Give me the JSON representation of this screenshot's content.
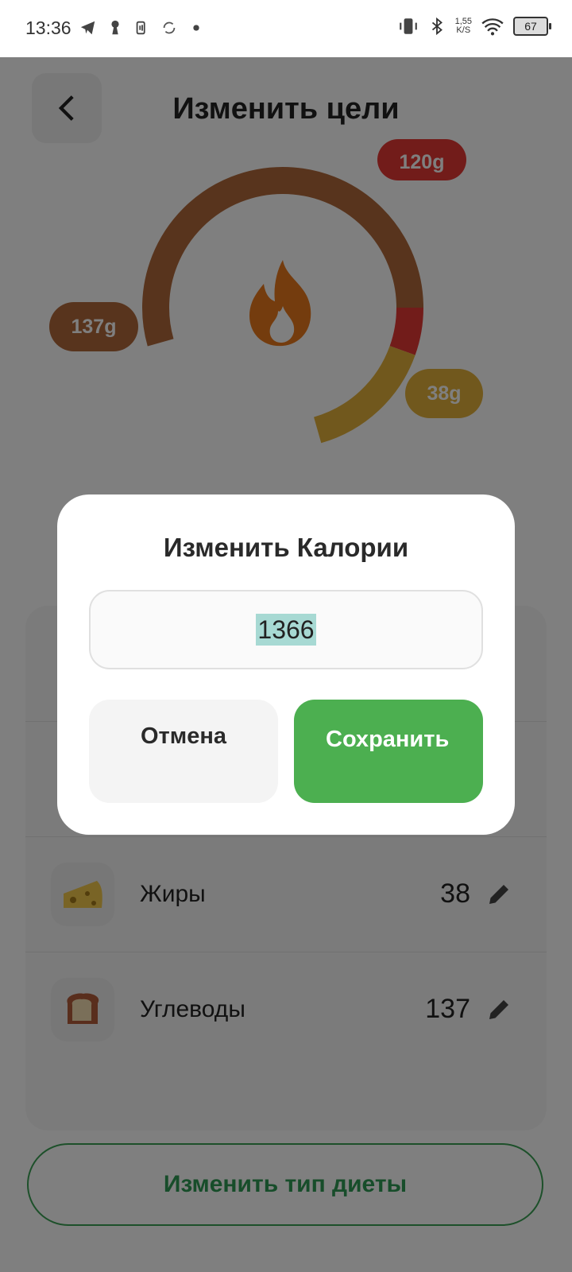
{
  "status_bar": {
    "time": "13:36",
    "net_speed_value": "1,55",
    "net_speed_unit": "K/S",
    "battery": "67"
  },
  "header": {
    "title": "Изменить цели"
  },
  "chart": {
    "protein_label": "120g",
    "fat_label": "38g",
    "carbs_label": "137g",
    "colors": {
      "protein": "#e53935",
      "fat": "#e3b03b",
      "carbs": "#b0683a",
      "flame": "#e8781c"
    }
  },
  "macros": [
    {
      "label": "Жиры",
      "value": "38",
      "icon": "cheese-icon"
    },
    {
      "label": "Углеводы",
      "value": "137",
      "icon": "bread-icon"
    }
  ],
  "diet_button": {
    "label": "Изменить тип диеты"
  },
  "dialog": {
    "title": "Изменить Калории",
    "input_value": "1366",
    "cancel_label": "Отмена",
    "save_label": "Сохранить"
  },
  "accent_colors": {
    "green": "#4caf50",
    "diet_outline": "#3aa055"
  }
}
